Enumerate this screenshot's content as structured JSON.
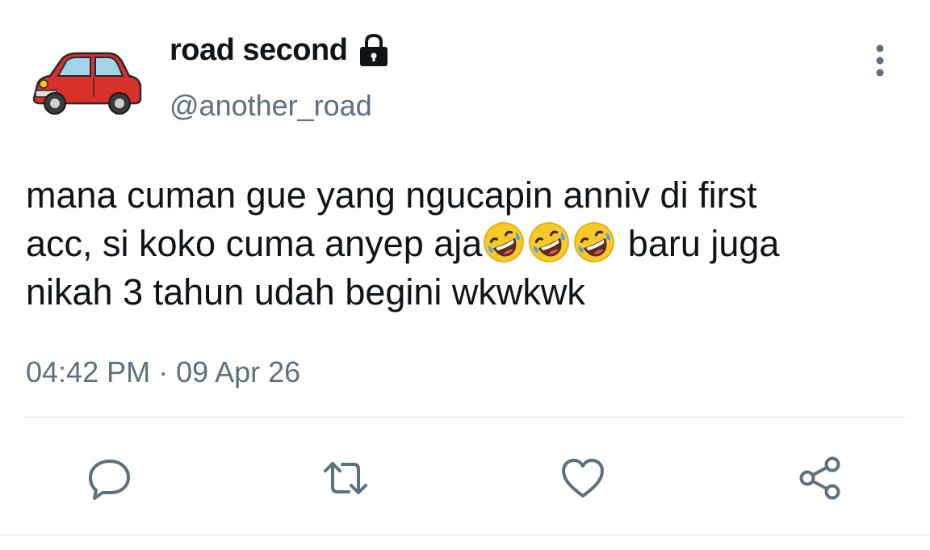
{
  "tweet": {
    "author": {
      "display_name": "road second",
      "handle": "@another_road",
      "protected": true,
      "avatar_icon": "red-car-icon"
    },
    "text_lines": [
      {
        "before": "mana cuman gue yang ngucapin anniv di first",
        "emojis": 0,
        "after": ""
      },
      {
        "before": "acc, si koko cuma anyep aja",
        "emojis": 3,
        "after": " baru juga"
      },
      {
        "before": "nikah 3 tahun udah begini wkwkwk",
        "emojis": 0,
        "after": ""
      }
    ],
    "emoji": "🤣",
    "timestamp": "04:42 PM · 09 Apr 26"
  },
  "actions": {
    "reply_icon": "reply-icon",
    "retweet_icon": "retweet-icon",
    "like_icon": "heart-icon",
    "share_icon": "share-icon",
    "more_icon": "more-vertical-icon"
  },
  "colors": {
    "text": "#0f1419",
    "secondary": "#5b7083",
    "divider": "#e1e8ed"
  }
}
